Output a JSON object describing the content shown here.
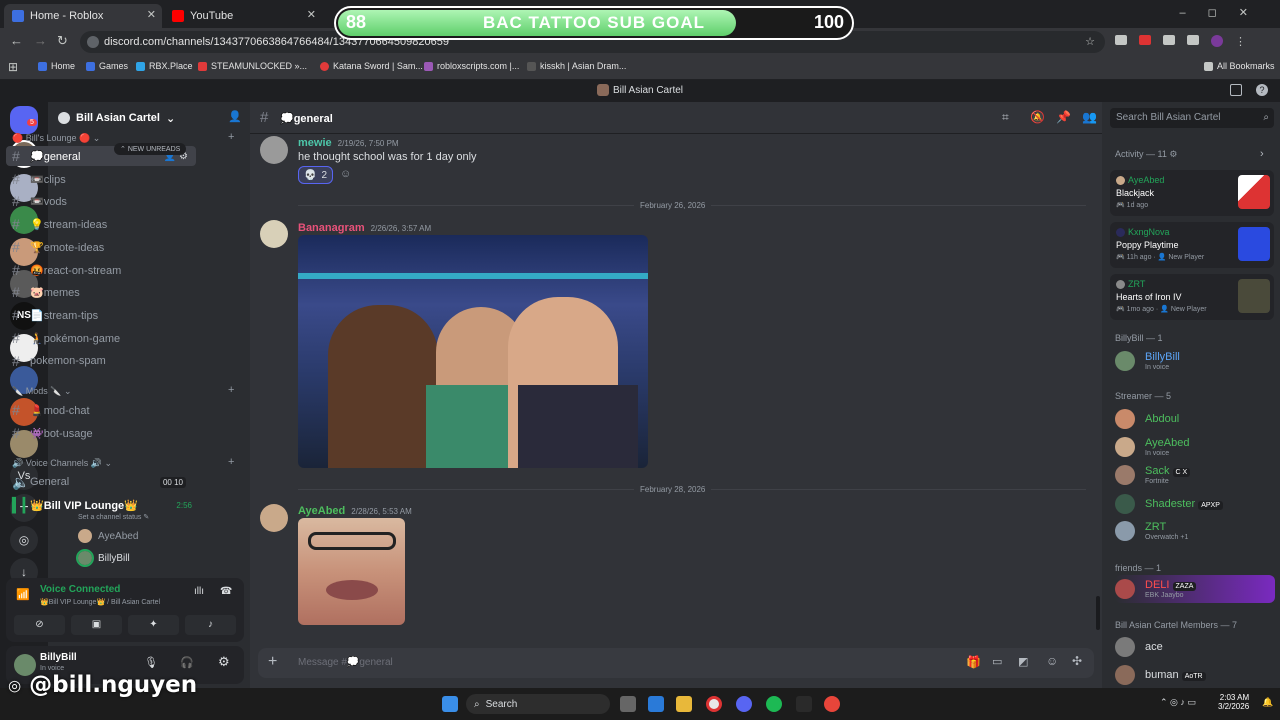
{
  "browser": {
    "tabs": [
      {
        "label": "Home - Roblox",
        "color": "#3d6fe0"
      },
      {
        "label": "YouTube",
        "color": "#ff0000"
      }
    ],
    "url": "discord.com/channels/1343770663864766484/1343770664509820659",
    "bookmarks": [
      {
        "label": "Home",
        "color": "#3d6fe0"
      },
      {
        "label": "Games",
        "color": "#3d6fe0"
      },
      {
        "label": "RBX.Place",
        "color": "#2fa4e7"
      },
      {
        "label": "STEAMUNLOCKED »...",
        "color": "#e03a3a"
      },
      {
        "label": "Katana Sword | Sam...",
        "color": "#e03a3a"
      },
      {
        "label": "robloxscripts.com |...",
        "color": "#9b59b6"
      },
      {
        "label": "kisskh | Asian Dram...",
        "color": "#555"
      }
    ],
    "all_bookmarks": "All Bookmarks"
  },
  "sub_goal": {
    "current": "88",
    "title": "BAC TATTOO SUB GOAL",
    "target": "100",
    "progress": 0.88
  },
  "discord": {
    "window_title": "Bill Asian Cartel",
    "server_name": "Bill Asian Cartel",
    "rail_badge": "5",
    "categories": {
      "lounge": "Bill's Lounge",
      "mods": "Mods",
      "voice": "Voice Channels"
    },
    "new_unreads": "NEW UNREADS",
    "channels": [
      {
        "label": "💭general",
        "active": true
      },
      {
        "label": "📼clips"
      },
      {
        "label": "📼vods"
      },
      {
        "label": "💡stream-ideas"
      },
      {
        "label": "🏆emote-ideas"
      },
      {
        "label": "🤬react-on-stream"
      },
      {
        "label": "🐷memes"
      },
      {
        "label": "📄stream-tips"
      },
      {
        "label": "🧎pokémon-game"
      },
      {
        "label": "pokemon-spam"
      }
    ],
    "mod_channels": [
      {
        "label": "💄mod-chat"
      },
      {
        "label": "👾bot-usage"
      }
    ],
    "voice_channels": [
      {
        "label": "General",
        "count_a": "00",
        "count_b": "10"
      },
      {
        "label": "👑Bill VIP Lounge👑",
        "time": "2:56",
        "status": "Set a channel status"
      }
    ],
    "voice_users": [
      "AyeAbed",
      "BillyBill"
    ],
    "voice_panel": {
      "status": "Voice Connected",
      "location": "👑Bill VIP Lounge👑 / Bill Asian Cartel"
    },
    "user_panel": {
      "name": "BillyBill",
      "status": "In voice"
    },
    "channel_header": "💭general",
    "search_placeholder": "Search Bill Asian Cartel",
    "messages": [
      {
        "user": "mewie",
        "time": "2/19/26, 7:50 PM",
        "text": "he thought school was for 1 day only",
        "reaction": "💀",
        "reaction_count": "2",
        "color": "#4dc6a9"
      },
      {
        "user": "Bananagram",
        "time": "2/26/26, 3:57 AM",
        "color": "#e8527a"
      },
      {
        "user": "AyeAbed",
        "time": "2/28/26, 5:53 AM",
        "color": "#4dbe5e"
      }
    ],
    "date_dividers": [
      "February 26, 2026",
      "February 28, 2026"
    ],
    "composer_placeholder": "Message #💭general",
    "activity": {
      "header": "Activity — 11",
      "items": [
        {
          "user": "AyeAbed",
          "game": "Blackjack",
          "time": "1d ago",
          "extra": ""
        },
        {
          "user": "KxngNova",
          "game": "Poppy Playtime",
          "time": "11h ago",
          "extra": "New Player"
        },
        {
          "user": "ZRT",
          "game": "Hearts of Iron IV",
          "time": "1mo ago",
          "extra": "New Player"
        }
      ]
    },
    "member_sections": [
      {
        "title": "BillyBill — 1"
      },
      {
        "title": "Streamer — 5"
      },
      {
        "title": "friends — 1"
      },
      {
        "title": "Bill Asian Cartel Members — 7"
      }
    ],
    "members": [
      {
        "name": "BillyBill",
        "status": "In voice",
        "color": "#5ba3f5"
      },
      {
        "name": "Abdoul",
        "status": "",
        "color": "#4dbe5e"
      },
      {
        "name": "AyeAbed",
        "status": "In voice",
        "color": "#4dbe5e"
      },
      {
        "name": "Sack",
        "status": "Fortnite",
        "tag": "C X",
        "color": "#4dbe5e"
      },
      {
        "name": "Shadester",
        "status": "",
        "tag": "APXP",
        "color": "#4dbe5e"
      },
      {
        "name": "ZRT",
        "status": "Overwatch +1",
        "color": "#4dbe5e"
      },
      {
        "name": "DELI",
        "status": "EBK Jaaybo",
        "tag": "ZAZA",
        "color": "#ff4d4d"
      },
      {
        "name": "ace",
        "status": "",
        "color": "#dbdee1"
      },
      {
        "name": "buman",
        "status": "",
        "tag": "AoTR",
        "color": "#dbdee1"
      }
    ]
  },
  "taskbar": {
    "search": "Search",
    "time": "2:03 AM",
    "date": "3/2/2026"
  },
  "overlay_handle": "@bill.nguyen"
}
